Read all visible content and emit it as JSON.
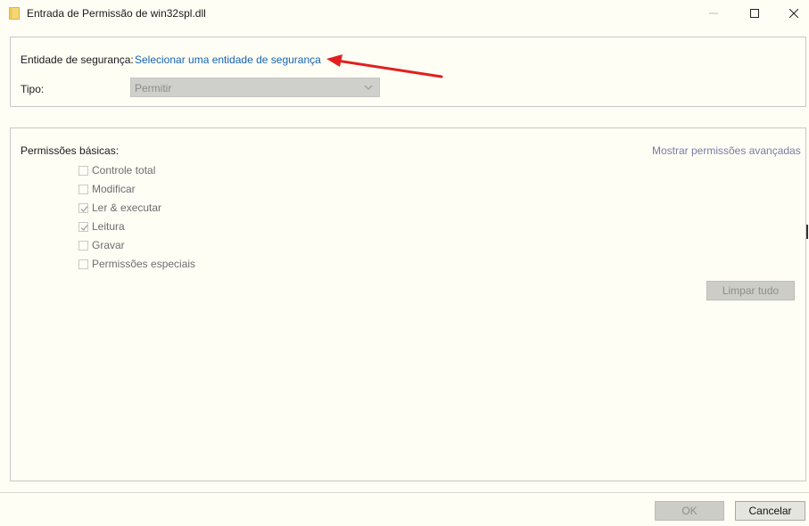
{
  "window": {
    "title": "Entrada de Permissão de win32spl.dll",
    "icon": "folder-icon"
  },
  "principal": {
    "label": "Entidade de segurança:",
    "link": "Selecionar uma entidade de segurança"
  },
  "type": {
    "label": "Tipo:",
    "value": "Permitir"
  },
  "permissions": {
    "label": "Permissões básicas:",
    "advanced_link": "Mostrar permissões avançadas",
    "items": [
      {
        "label": "Controle total",
        "checked": false
      },
      {
        "label": "Modificar",
        "checked": false
      },
      {
        "label": "Ler & executar",
        "checked": true
      },
      {
        "label": "Leitura",
        "checked": true
      },
      {
        "label": "Gravar",
        "checked": false
      },
      {
        "label": "Permissões especiais",
        "checked": false
      }
    ],
    "clear_button": "Limpar tudo"
  },
  "footer": {
    "ok": "OK",
    "cancel": "Cancelar"
  },
  "colors": {
    "background": "#fffef5",
    "link": "#1662b1",
    "annotation_arrow": "#e02020"
  }
}
